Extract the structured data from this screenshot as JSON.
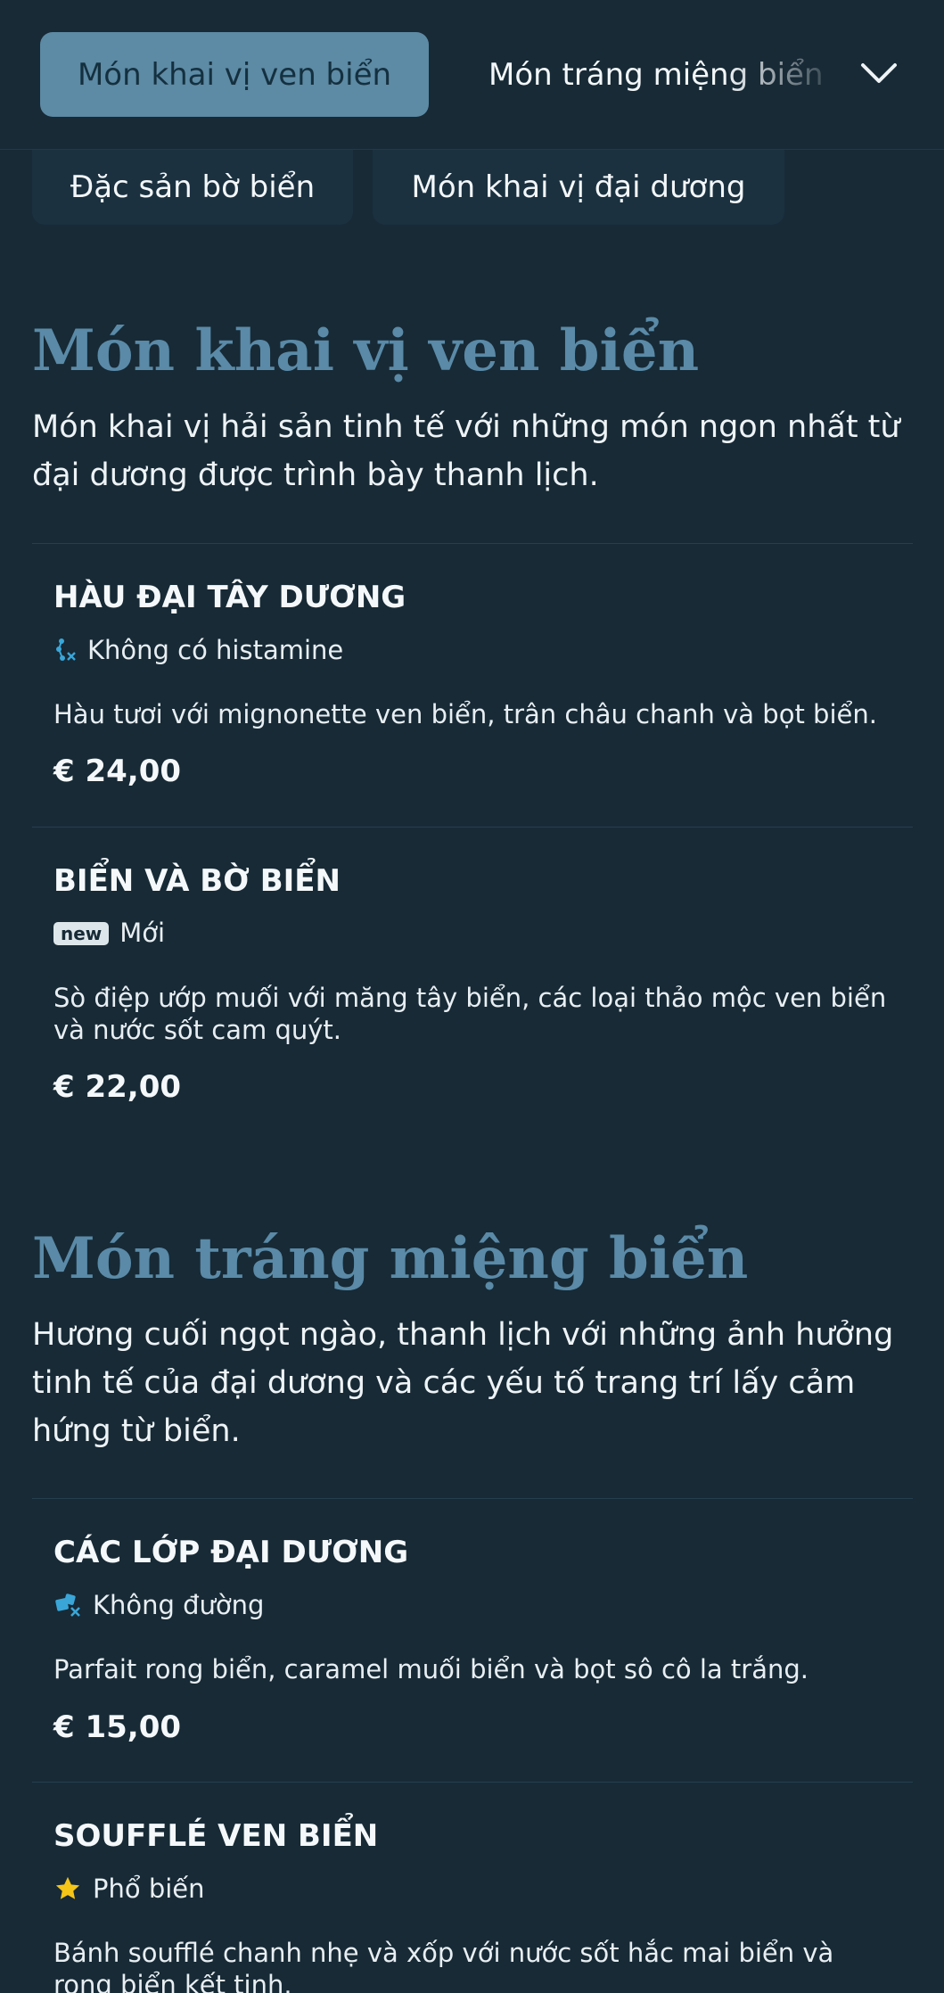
{
  "nav": {
    "active_tab": "Món khai vị ven biển",
    "next_tab": "Món tráng miệng biển",
    "chips": [
      "Đặc sản bờ biển",
      "Món khai vị đại dương"
    ]
  },
  "sections": [
    {
      "title": "Món khai vị ven biển",
      "description": "Món khai vị hải sản tinh tế với những món ngon nhất từ đại dương được trình bày thanh lịch.",
      "items": [
        {
          "name": "HÀU ĐẠI TÂY DƯƠNG",
          "tag_icon": "histamine-free-icon",
          "tag": "Không có histamine",
          "description": "Hàu tươi với mignonette ven biển, trân châu chanh và bọt biển.",
          "price": "€ 24,00"
        },
        {
          "name": "BIỂN VÀ BỜ BIỂN",
          "tag_icon": "new-badge-icon",
          "tag_badge": "new",
          "tag": "Mới",
          "description": "Sò điệp ướp muối với măng tây biển, các loại thảo mộc ven biển và nước sốt cam quýt.",
          "price": "€ 22,00"
        }
      ]
    },
    {
      "title": "Món tráng miệng biển",
      "description": "Hương cuối ngọt ngào, thanh lịch với những ảnh hưởng tinh tế của đại dương và các yếu tố trang trí lấy cảm hứng từ biển.",
      "items": [
        {
          "name": "CÁC LỚP ĐẠI DƯƠNG",
          "tag_icon": "sugar-free-icon",
          "tag": "Không đường",
          "description": "Parfait rong biển, caramel muối biển và bọt sô cô la trắng.",
          "price": "€ 15,00"
        },
        {
          "name": "SOUFFLÉ VEN BIỂN",
          "tag_icon": "star-icon",
          "tag": "Phổ biến",
          "description": "Bánh soufflé chanh nhẹ và xốp với nước sốt hắc mai biển và rong biển kết tinh."
        }
      ]
    }
  ],
  "colors": {
    "background": "#172a36",
    "accent": "#5d8aa4",
    "title": "#5a8aa7",
    "icon_blue": "#3aa6d8",
    "star": "#f5c518"
  }
}
